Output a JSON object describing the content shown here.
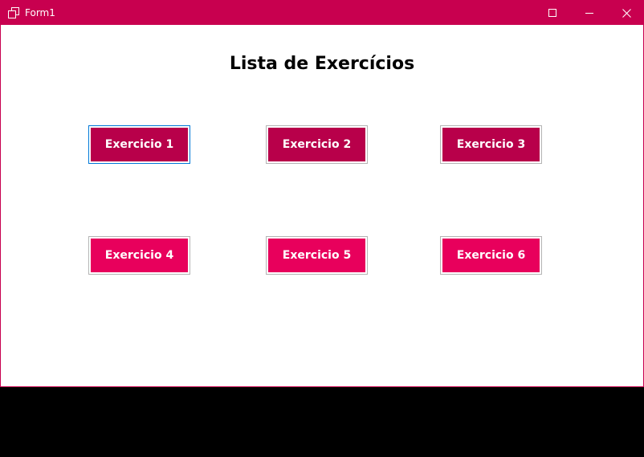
{
  "window": {
    "title": "Form1",
    "colors": {
      "titlebar": "#c8004f",
      "client": "#ffffff",
      "focus_border": "#0078d7"
    }
  },
  "main": {
    "heading": "Lista de Exercícios"
  },
  "buttons": [
    {
      "label": "Exercicio 1",
      "color": "#b8004a",
      "focused": true
    },
    {
      "label": "Exercicio 2",
      "color": "#b8004a",
      "focused": false
    },
    {
      "label": "Exercicio 3",
      "color": "#b8004a",
      "focused": false
    },
    {
      "label": "Exercicio 4",
      "color": "#e8005c",
      "focused": false
    },
    {
      "label": "Exercicio 5",
      "color": "#e8005c",
      "focused": false
    },
    {
      "label": "Exercicio 6",
      "color": "#e8005c",
      "focused": false
    }
  ]
}
